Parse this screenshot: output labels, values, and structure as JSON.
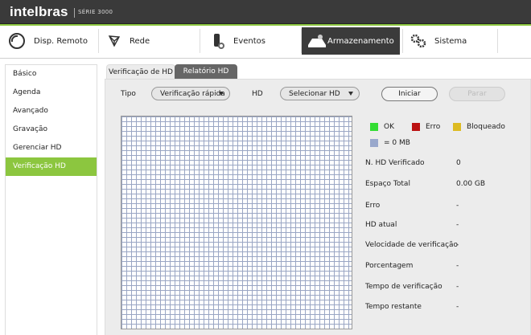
{
  "brand": {
    "name": "intelbras",
    "series": "SÉRIE 3000"
  },
  "nav": {
    "tabs": [
      {
        "label": "Disp. Remoto",
        "icon": "remote-device-icon"
      },
      {
        "label": "Rede",
        "icon": "network-icon"
      },
      {
        "label": "Eventos",
        "icon": "events-icon"
      },
      {
        "label": "Armazenamento",
        "icon": "storage-icon",
        "active": true
      },
      {
        "label": "Sistema",
        "icon": "gears-icon"
      }
    ]
  },
  "sidebar": {
    "items": [
      {
        "label": "Básico"
      },
      {
        "label": "Agenda"
      },
      {
        "label": "Avançado"
      },
      {
        "label": "Gravação"
      },
      {
        "label": "Gerenciar HD"
      },
      {
        "label": "Verificação HD",
        "active": true
      }
    ]
  },
  "panel": {
    "tabs": [
      {
        "label": "Verificação de HD",
        "active": true
      },
      {
        "label": "Relatório HD"
      }
    ],
    "tipo_label": "Tipo",
    "tipo_value": "Verificação rápida",
    "hd_label": "HD",
    "hd_value": "Selecionar HD",
    "start_button": "Iniciar",
    "stop_button": "Parar"
  },
  "legend": {
    "ok": "OK",
    "error": "Erro",
    "blocked": "Bloqueado",
    "block_size": "= 0 MB",
    "colors": {
      "ok": "#33dd33",
      "error": "#bb1111",
      "blocked": "#ddbb22",
      "block": "#99a8cc"
    }
  },
  "info": [
    {
      "label": "N. HD Verificado",
      "value": "0"
    },
    {
      "label": "Espaço Total",
      "value": "0.00 GB"
    },
    {
      "label": "Erro",
      "value": "-"
    },
    {
      "label": "HD atual",
      "value": "-"
    },
    {
      "label": "Velocidade de verificação",
      "value": "-"
    },
    {
      "label": "Porcentagem",
      "value": "-"
    },
    {
      "label": "Tempo de verificação",
      "value": "-"
    },
    {
      "label": "Tempo restante",
      "value": "-"
    }
  ],
  "accent_color": "#8cc63f"
}
